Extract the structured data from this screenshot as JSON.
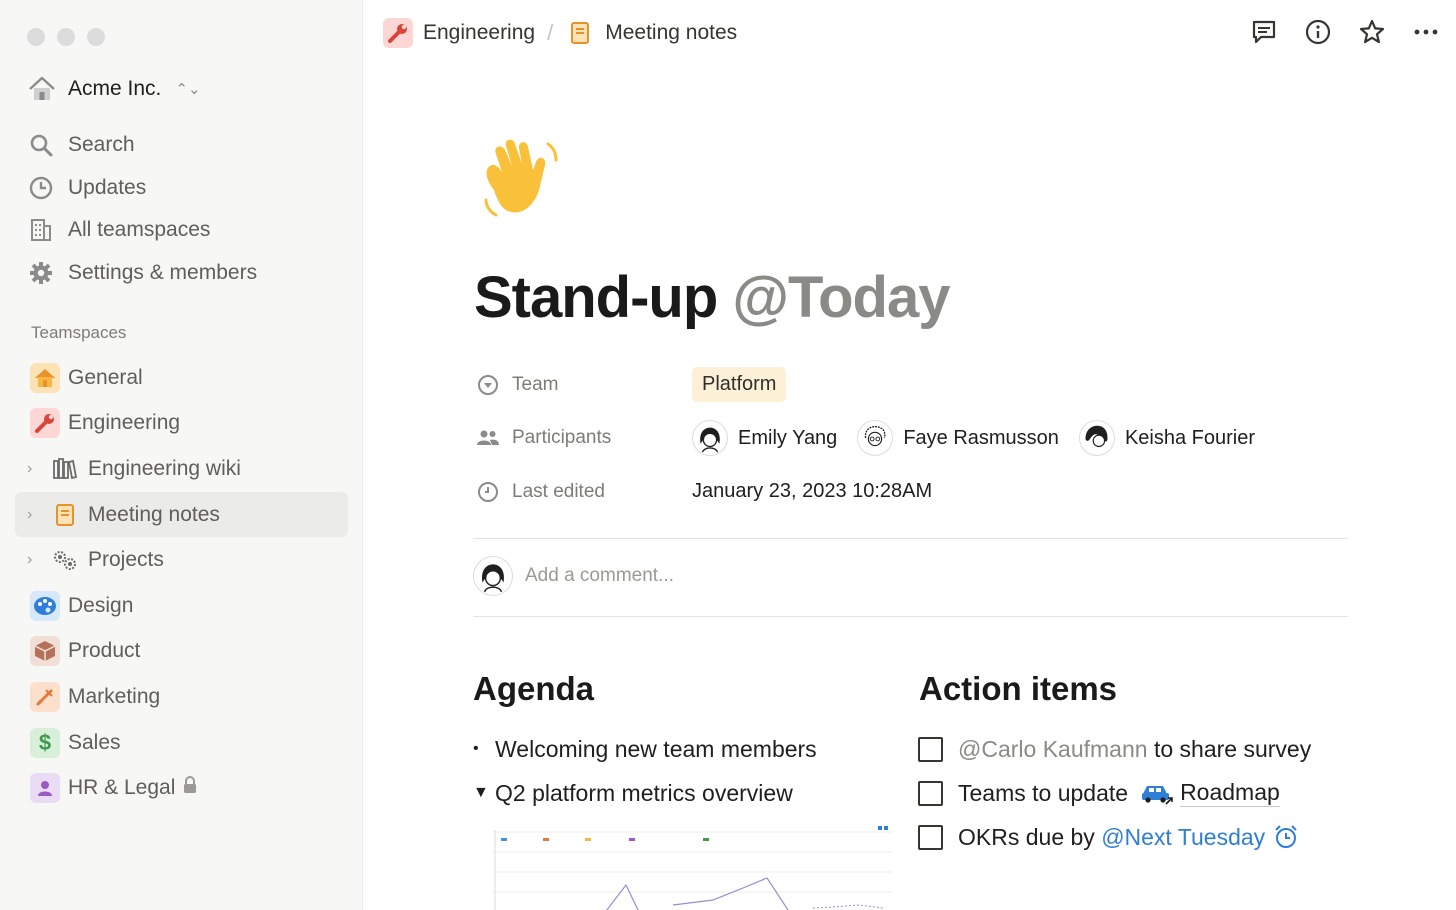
{
  "workspace": {
    "name": "Acme Inc."
  },
  "nav": [
    {
      "label": "Search",
      "icon": "search-icon"
    },
    {
      "label": "Updates",
      "icon": "clock-icon"
    },
    {
      "label": "All teamspaces",
      "icon": "building-icon"
    },
    {
      "label": "Settings & members",
      "icon": "gear-icon"
    }
  ],
  "teamspaces_label": "Teamspaces",
  "teamspaces": [
    {
      "label": "General",
      "icon": "house-icon",
      "bg": "#fbe3b6"
    },
    {
      "label": "Engineering",
      "icon": "wrench-icon",
      "bg": "#fcd7d5"
    },
    {
      "label": "Engineering wiki",
      "icon": "books-icon",
      "expandable": true
    },
    {
      "label": "Meeting notes",
      "icon": "notebook-icon",
      "expandable": true,
      "active": true
    },
    {
      "label": "Projects",
      "icon": "gears-icon",
      "expandable": true
    },
    {
      "label": "Design",
      "icon": "palette-icon",
      "bg": "#d6e8fa"
    },
    {
      "label": "Product",
      "icon": "box-icon",
      "bg": "#f1dfd6"
    },
    {
      "label": "Marketing",
      "icon": "pen-icon",
      "bg": "#fde0cc"
    },
    {
      "label": "Sales",
      "icon": "dollar-icon",
      "bg": "#d8efd9"
    },
    {
      "label": "HR & Legal",
      "icon": "person-icon",
      "bg": "#eadcf4",
      "locked": true
    }
  ],
  "breadcrumb": [
    {
      "label": "Engineering",
      "icon": "wrench-icon"
    },
    {
      "label": "Meeting notes",
      "icon": "notebook-icon"
    }
  ],
  "page": {
    "title": "Stand-up",
    "title_mention": "@Today",
    "properties": {
      "team_label": "Team",
      "team_value": "Platform",
      "participants_label": "Participants",
      "participants": [
        "Emily Yang",
        "Faye Rasmusson",
        "Keisha Fourier"
      ],
      "last_edited_label": "Last edited",
      "last_edited_value": "January 23, 2023 10:28AM"
    },
    "comment_placeholder": "Add a comment..."
  },
  "agenda": {
    "title": "Agenda",
    "items": [
      {
        "text": "Welcoming new team members",
        "marker": "•"
      },
      {
        "text": "Q2 platform metrics overview",
        "marker": "▼"
      }
    ]
  },
  "action_items": {
    "title": "Action items",
    "items": [
      {
        "mention": "@Carlo Kaufmann",
        "text": " to share survey"
      },
      {
        "text": "Teams to update",
        "link": "Roadmap"
      },
      {
        "text": "OKRs due by ",
        "date_mention": "@Next Tuesday"
      }
    ]
  },
  "colors": {
    "accent_blue": "#2f7ed8",
    "sidebar_bg": "#f7f7f5",
    "pill_bg": "#fcf1d6"
  }
}
